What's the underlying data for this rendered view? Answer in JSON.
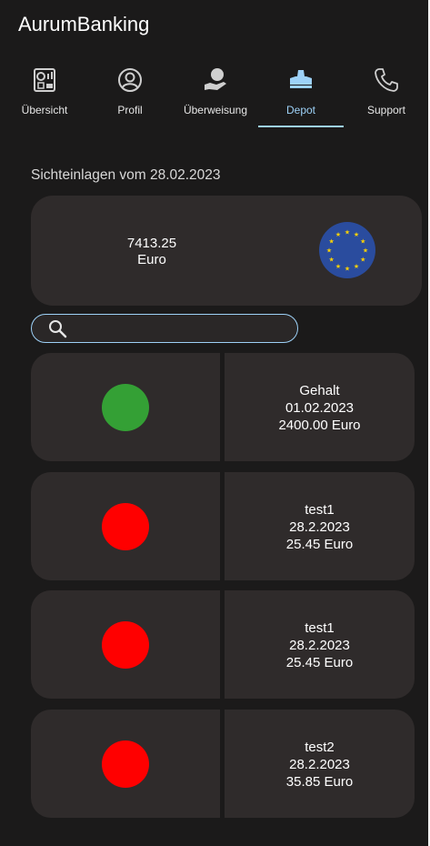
{
  "app": {
    "title": "AurumBanking"
  },
  "tabs": [
    {
      "label": "Übersicht",
      "icon": "chart-report-icon",
      "active": false
    },
    {
      "label": "Profil",
      "icon": "user-icon",
      "active": false
    },
    {
      "label": "Überweisung",
      "icon": "money-hand-icon",
      "active": false
    },
    {
      "label": "Depot",
      "icon": "depot-icon",
      "active": true
    },
    {
      "label": "Support",
      "icon": "phone-icon",
      "active": false
    }
  ],
  "subtitle": "Sichteinlagen vom 28.02.2023",
  "balance": {
    "amount": "7413.25",
    "currency": "Euro",
    "icon": "eu-flag-icon"
  },
  "search": {
    "placeholder": "",
    "value": ""
  },
  "transactions": [
    {
      "name": "Gehalt",
      "date": "01.02.2023",
      "amount": "2400.00 Euro",
      "status": "income",
      "color": "#34a035"
    },
    {
      "name": "test1",
      "date": "28.2.2023",
      "amount": "25.45 Euro",
      "status": "expense",
      "color": "#ff0000"
    },
    {
      "name": "test1",
      "date": "28.2.2023",
      "amount": "25.45 Euro",
      "status": "expense",
      "color": "#ff0000"
    },
    {
      "name": "test2",
      "date": "28.2.2023",
      "amount": "35.85 Euro",
      "status": "expense",
      "color": "#ff0000"
    }
  ],
  "colors": {
    "background": "#1b1a1a",
    "card": "#2f2b2b",
    "accent": "#9dd1f7",
    "income": "#34a035",
    "expense": "#ff0000"
  }
}
